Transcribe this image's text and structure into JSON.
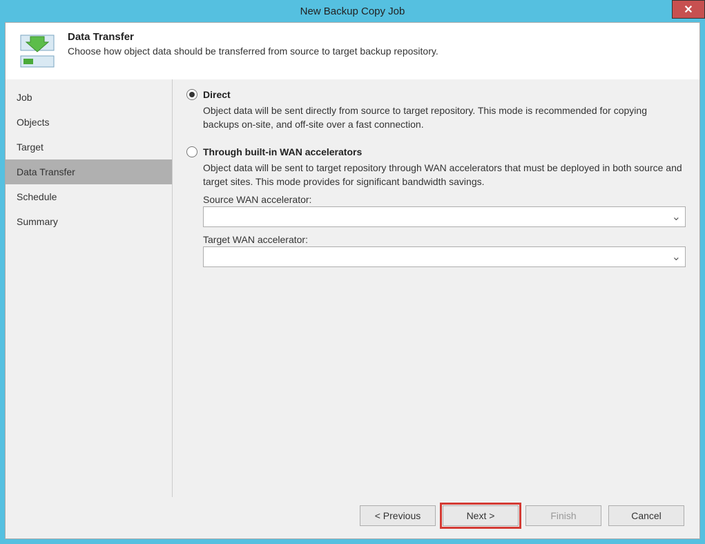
{
  "window": {
    "title": "New Backup Copy Job",
    "close_tooltip": "Close"
  },
  "header": {
    "title": "Data Transfer",
    "description": "Choose how object data should be transferred from source to target backup repository."
  },
  "sidebar": {
    "items": [
      {
        "label": "Job"
      },
      {
        "label": "Objects"
      },
      {
        "label": "Target"
      },
      {
        "label": "Data Transfer"
      },
      {
        "label": "Schedule"
      },
      {
        "label": "Summary"
      }
    ]
  },
  "main": {
    "options": {
      "direct": {
        "label": "Direct",
        "description": "Object data will be sent directly from source to target repository. This mode is recommended for copying backups on-site, and off-site over a fast connection."
      },
      "wan": {
        "label": "Through built-in WAN accelerators",
        "description": "Object data will be sent to target repository through WAN accelerators that must be deployed in both source and target sites. This mode provides for significant bandwidth savings.",
        "source_label": "Source WAN accelerator:",
        "source_value": "",
        "target_label": "Target WAN accelerator:",
        "target_value": ""
      }
    }
  },
  "footer": {
    "previous": "< Previous",
    "next": "Next >",
    "finish": "Finish",
    "cancel": "Cancel"
  }
}
